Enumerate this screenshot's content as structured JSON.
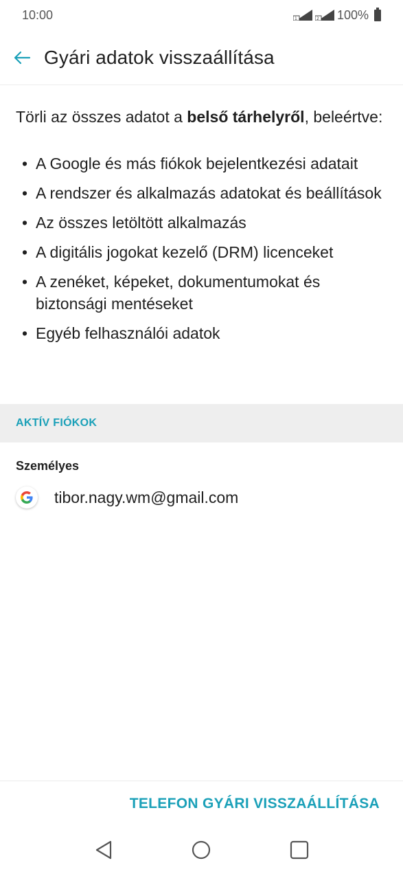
{
  "status_bar": {
    "time": "10:00",
    "battery": "100%",
    "icons": [
      "signal-sim1-icon",
      "signal-sim2-icon",
      "battery-icon"
    ]
  },
  "header": {
    "title": "Gyári adatok visszaállítása",
    "back_icon": "back-arrow-icon"
  },
  "intro": {
    "prefix": "Törli az összes adatot a ",
    "bold": "belső tárhelyről",
    "suffix": ", beleértve:"
  },
  "bullets": [
    "A Google és más fiókok bejelentkezési adatait",
    "A rendszer és alkalmazás adatokat és beállítások",
    "Az összes letöltött alkalmazás",
    "A digitális jogokat kezelő (DRM) licenceket",
    "A zenéket, képeket, dokumentumokat és biztonsági mentéseket",
    "Egyéb felhasználói adatok"
  ],
  "accounts": {
    "section_title": "AKTÍV FIÓKOK",
    "group_label": "Személyes",
    "items": [
      {
        "icon": "google-icon",
        "email": "tibor.nagy.wm@gmail.com"
      }
    ]
  },
  "action": {
    "reset_label": "TELEFON GYÁRI VISSZAÁLLÍTÁSA"
  },
  "nav": {
    "icons": [
      "back-nav-icon",
      "home-nav-icon",
      "recents-nav-icon"
    ]
  },
  "colors": {
    "accent": "#1aa0b8",
    "section_bg": "#eeeeee",
    "text": "#1f1f1f"
  }
}
